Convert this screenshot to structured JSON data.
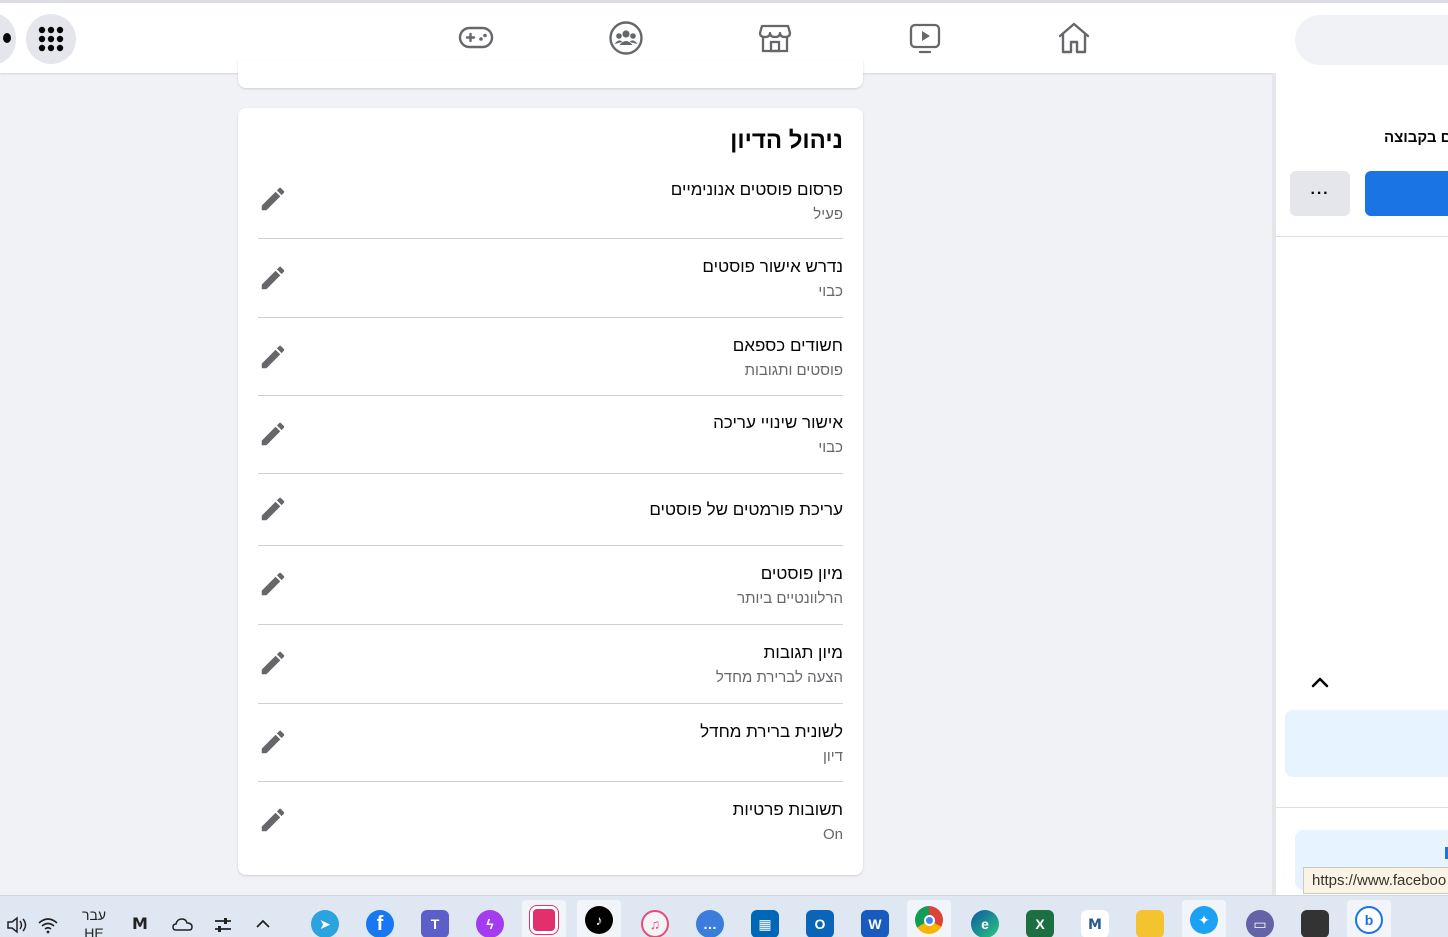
{
  "nav": {
    "icons": [
      "menu-grid-icon",
      "gaming-icon",
      "groups-icon",
      "marketplace-icon",
      "watch-icon",
      "home-icon"
    ]
  },
  "card": {
    "title": "ניהול הדיון",
    "rows": [
      {
        "title": "פרסום פוסטים אנונימיים",
        "subtitle": "פעיל"
      },
      {
        "title": "נדרש אישור פוסטים",
        "subtitle": "כבוי"
      },
      {
        "title": "חשודים כספאם",
        "subtitle": "פוסטים ותגובות"
      },
      {
        "title": "אישור שינויי עריכה",
        "subtitle": "כבוי"
      },
      {
        "title": "עריכת פורמטים של פוסטים",
        "subtitle": ""
      },
      {
        "title": "מיון פוסטים",
        "subtitle": "הרלוונטיים ביותר"
      },
      {
        "title": "מיון תגובות",
        "subtitle": "הצעה לברירת מחדל"
      },
      {
        "title": "לשונית ברירת מחדל",
        "subtitle": "דיון"
      },
      {
        "title": "תשובות פרטיות",
        "subtitle": "On"
      }
    ]
  },
  "right_panel": {
    "partial_text": "ים בקבוצה",
    "more_label": "···",
    "url_tooltip": "https://www.faceboo"
  },
  "taskbar": {
    "lang_line1": "עבר",
    "lang_line2": "HE",
    "apps": [
      "telegram",
      "facebook",
      "teams",
      "messenger",
      "instagram",
      "tiktok",
      "itunes",
      "chat",
      "store",
      "outlook",
      "word",
      "chrome",
      "edge",
      "excel",
      "mx",
      "explorer",
      "twitter",
      "zoom",
      "taskmgr",
      "bing"
    ]
  },
  "colors": {
    "accent": "#1b74e4",
    "background": "#f0f2f5",
    "secondary_text": "#65676b"
  }
}
